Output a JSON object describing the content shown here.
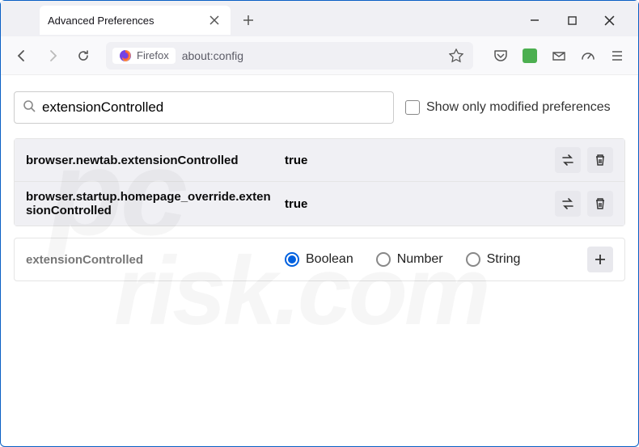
{
  "window": {
    "tab_title": "Advanced Preferences"
  },
  "toolbar": {
    "identity_label": "Firefox",
    "url": "about:config"
  },
  "config": {
    "search_value": "extensionControlled",
    "show_modified_label": "Show only modified preferences",
    "rows": [
      {
        "name": "browser.newtab.extensionControlled",
        "value": "true"
      },
      {
        "name": "browser.startup.homepage_override.extensionControlled",
        "value": "true"
      }
    ],
    "new_pref": {
      "name": "extensionControlled",
      "types": {
        "boolean": "Boolean",
        "number": "Number",
        "string": "String"
      }
    }
  }
}
